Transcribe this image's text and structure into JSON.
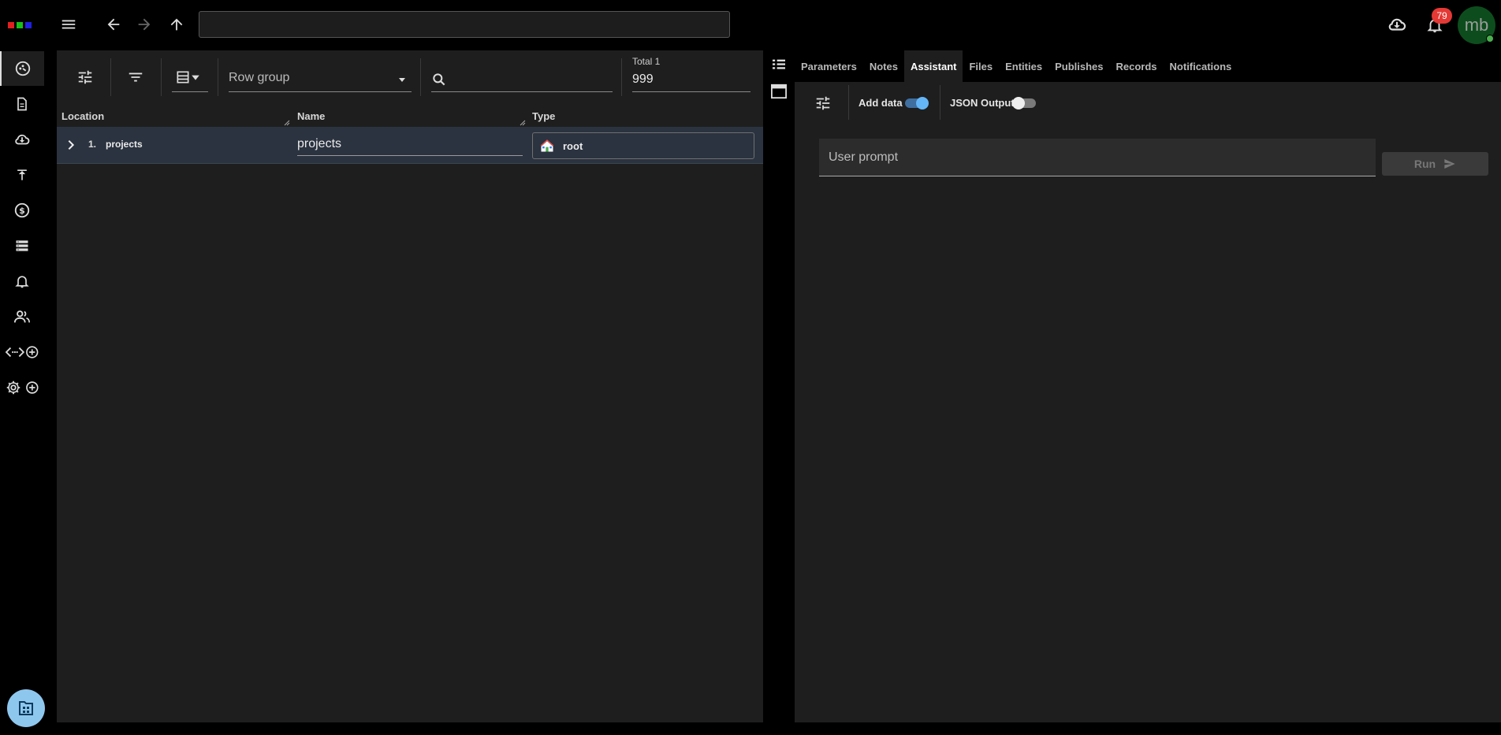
{
  "colors": {
    "logo": [
      "#e02020",
      "#18c018",
      "#2020e0"
    ],
    "avatar_bg": "#0d4d1d",
    "badge": "#e53935",
    "fab": "#8ec7ee",
    "row_selected": "#2b3340"
  },
  "topbar": {
    "address_value": "",
    "icons": [
      "menu-icon",
      "back-arrow-icon",
      "forward-arrow-icon",
      "up-arrow-icon",
      "cloud-download-icon",
      "bell-icon"
    ],
    "notification_count": "79",
    "avatar_initials": "mb"
  },
  "sidebar": {
    "items": [
      {
        "icon": "dashboard-icon",
        "active": true
      },
      {
        "icon": "document-icon"
      },
      {
        "icon": "cloud-download-icon"
      },
      {
        "icon": "publish-icon"
      },
      {
        "icon": "billing-icon"
      },
      {
        "icon": "storage-icon"
      },
      {
        "icon": "bell-icon"
      },
      {
        "icon": "users-icon"
      },
      {
        "icon": "api-add-icon"
      },
      {
        "icon": "settings-add-icon"
      }
    ],
    "fab_icon": "folder-tree-icon"
  },
  "table_panel": {
    "row_group_placeholder": "Row group",
    "search_value": "",
    "total_label": "Total 1",
    "page_size": "999",
    "columns": [
      "Location",
      "Name",
      "Type"
    ],
    "rows": [
      {
        "index": "1.",
        "location": "projects",
        "name": "projects",
        "type": "root",
        "type_icon": "house-icon"
      }
    ]
  },
  "detail_panel": {
    "tabs": [
      {
        "label": "Parameters"
      },
      {
        "label": "Notes"
      },
      {
        "label": "Assistant",
        "active": true
      },
      {
        "label": "Files"
      },
      {
        "label": "Entities"
      },
      {
        "label": "Publishes"
      },
      {
        "label": "Records"
      },
      {
        "label": "Notifications"
      }
    ],
    "add_data_label": "Add data",
    "add_data_on": true,
    "json_output_label": "JSON Output",
    "json_output_on": false,
    "prompt_placeholder": "User prompt",
    "run_label": "Run"
  }
}
